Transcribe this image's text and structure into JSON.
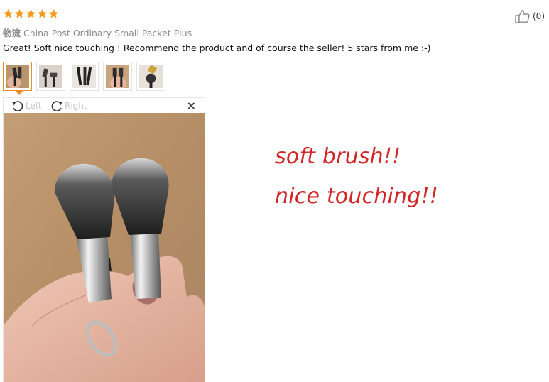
{
  "review": {
    "rating": 5,
    "rating_max": 5,
    "star_color": "#f59a1b",
    "logistics_label": "物流",
    "logistics_value": "China Post Ordinary Small Packet Plus",
    "text": "Great! Soft nice touching ! Recommend the product and of course the seller! 5 stars from me :-)",
    "likes": "(0)",
    "like_icon": "thumbs-up-icon"
  },
  "thumbnails": [
    {
      "name": "photo-1",
      "active": true
    },
    {
      "name": "photo-2",
      "active": false
    },
    {
      "name": "photo-3",
      "active": false
    },
    {
      "name": "photo-4",
      "active": false
    },
    {
      "name": "photo-5",
      "active": false
    }
  ],
  "viewer": {
    "rotate_left_label": "Left",
    "rotate_right_label": "Right",
    "close_label": "×",
    "accent_color": "#f08a24"
  },
  "annotations": {
    "line1": "soft brush!!",
    "line2": "nice touching!!",
    "color": "#d02626"
  }
}
